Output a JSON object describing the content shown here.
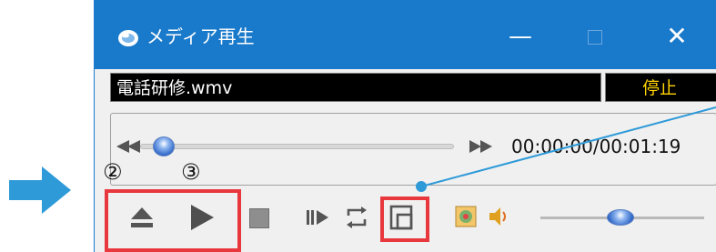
{
  "window": {
    "title": "メディア再生",
    "minimize_glyph": "—",
    "close_glyph": "✕"
  },
  "file": {
    "name": "電話研修.wmv",
    "status": "停止"
  },
  "seek": {
    "time": "00:00:00/00:01:19",
    "position": 0.0
  },
  "volume": {
    "level": 0.45
  },
  "annotations": {
    "marker_2": "②",
    "marker_3": "③",
    "highlight_color": "#e8383d"
  },
  "colors": {
    "titlebar": "#1979ca",
    "arrow": "#2e9ad8",
    "status_text": "#ffd200"
  },
  "icons": {
    "eject": "eject-icon",
    "play": "play-icon",
    "stop": "stop-icon",
    "frame_step": "frame-step-icon",
    "repeat": "repeat-icon",
    "window_mode": "window-mode-icon",
    "settings": "settings-icon",
    "volume": "volume-icon",
    "rewind": "rewind-icon",
    "fast_forward": "fast-forward-icon"
  }
}
